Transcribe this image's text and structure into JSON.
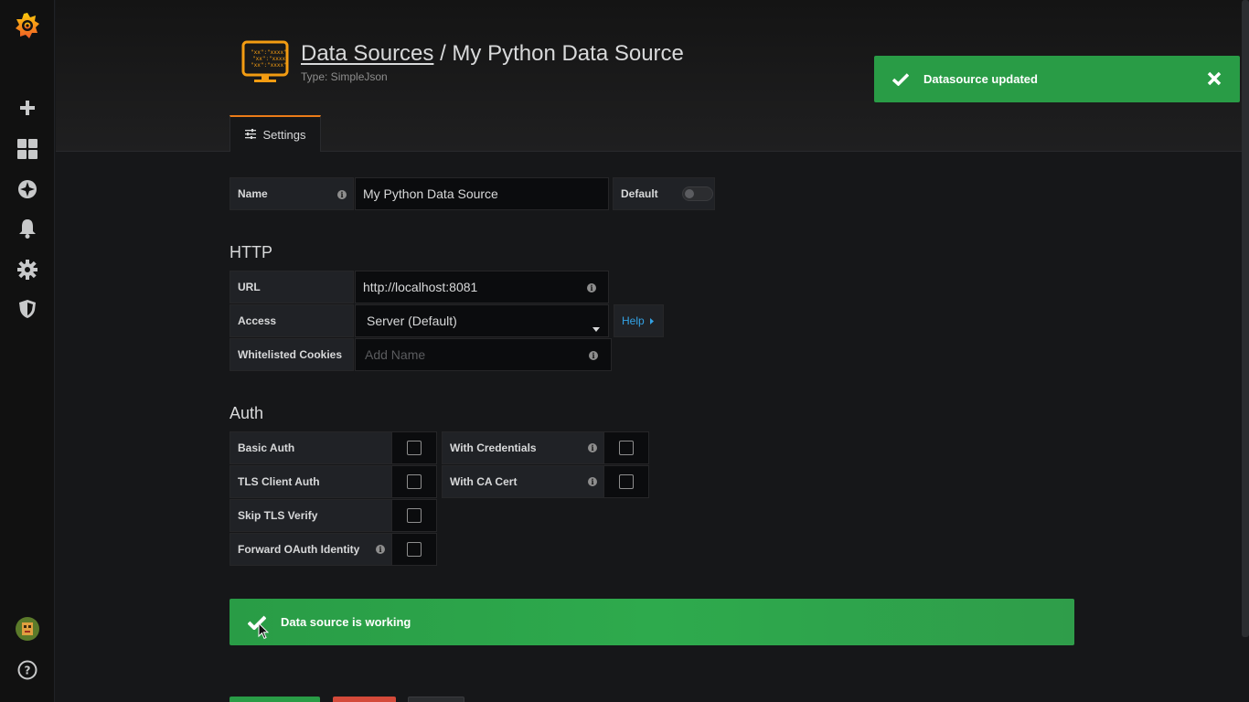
{
  "header": {
    "breadcrumb_link": "Data Sources",
    "separator": " / ",
    "title": "My Python Data Source",
    "subtitle": "Type: SimpleJson"
  },
  "tabs": [
    {
      "label": "Settings",
      "icon": "sliders-icon",
      "active": true
    }
  ],
  "toast": {
    "message": "Datasource updated",
    "color": "#299c46"
  },
  "form": {
    "name_label": "Name",
    "name_value": "My Python Data Source",
    "default_label": "Default",
    "default_on": false
  },
  "http": {
    "title": "HTTP",
    "url_label": "URL",
    "url_value": "http://localhost:8081",
    "access_label": "Access",
    "access_value": "Server (Default)",
    "help_label": "Help",
    "cookies_label": "Whitelisted Cookies",
    "cookies_placeholder": "Add Name"
  },
  "auth": {
    "title": "Auth",
    "basic_auth": "Basic Auth",
    "with_credentials": "With Credentials",
    "tls_client_auth": "TLS Client Auth",
    "with_ca_cert": "With CA Cert",
    "skip_tls_verify": "Skip TLS Verify",
    "forward_oauth": "Forward OAuth Identity"
  },
  "status": {
    "message": "Data source is working",
    "color": "#299c46"
  },
  "colors": {
    "accent": "#eb7b18",
    "link": "#33a2e5",
    "success": "#299c46",
    "danger": "#d44a3a"
  }
}
